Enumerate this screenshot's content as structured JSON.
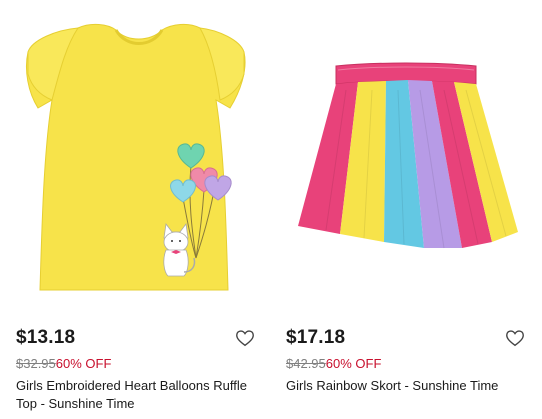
{
  "products": [
    {
      "price": "$13.18",
      "was_price": "$32.95",
      "discount": "60% OFF",
      "title": "Girls Embroidered Heart Balloons Ruffle Top - Sunshine Time",
      "image_icon": "yellow-shirt-image",
      "wishlist_icon": "heart-outline-icon"
    },
    {
      "price": "$17.18",
      "was_price": "$42.95",
      "discount": "60% OFF",
      "title": "Girls Rainbow Skort - Sunshine Time",
      "image_icon": "rainbow-skort-image",
      "wishlist_icon": "heart-outline-icon"
    }
  ],
  "colors": {
    "price": "#1a1a1a",
    "was_price": "#808080",
    "discount": "#c8102e",
    "shirt": "#f7e34a",
    "skort_stripes": [
      "#e8427a",
      "#f7e34a",
      "#63c8e3",
      "#b79be6",
      "#e8427a",
      "#f7e34a"
    ]
  }
}
